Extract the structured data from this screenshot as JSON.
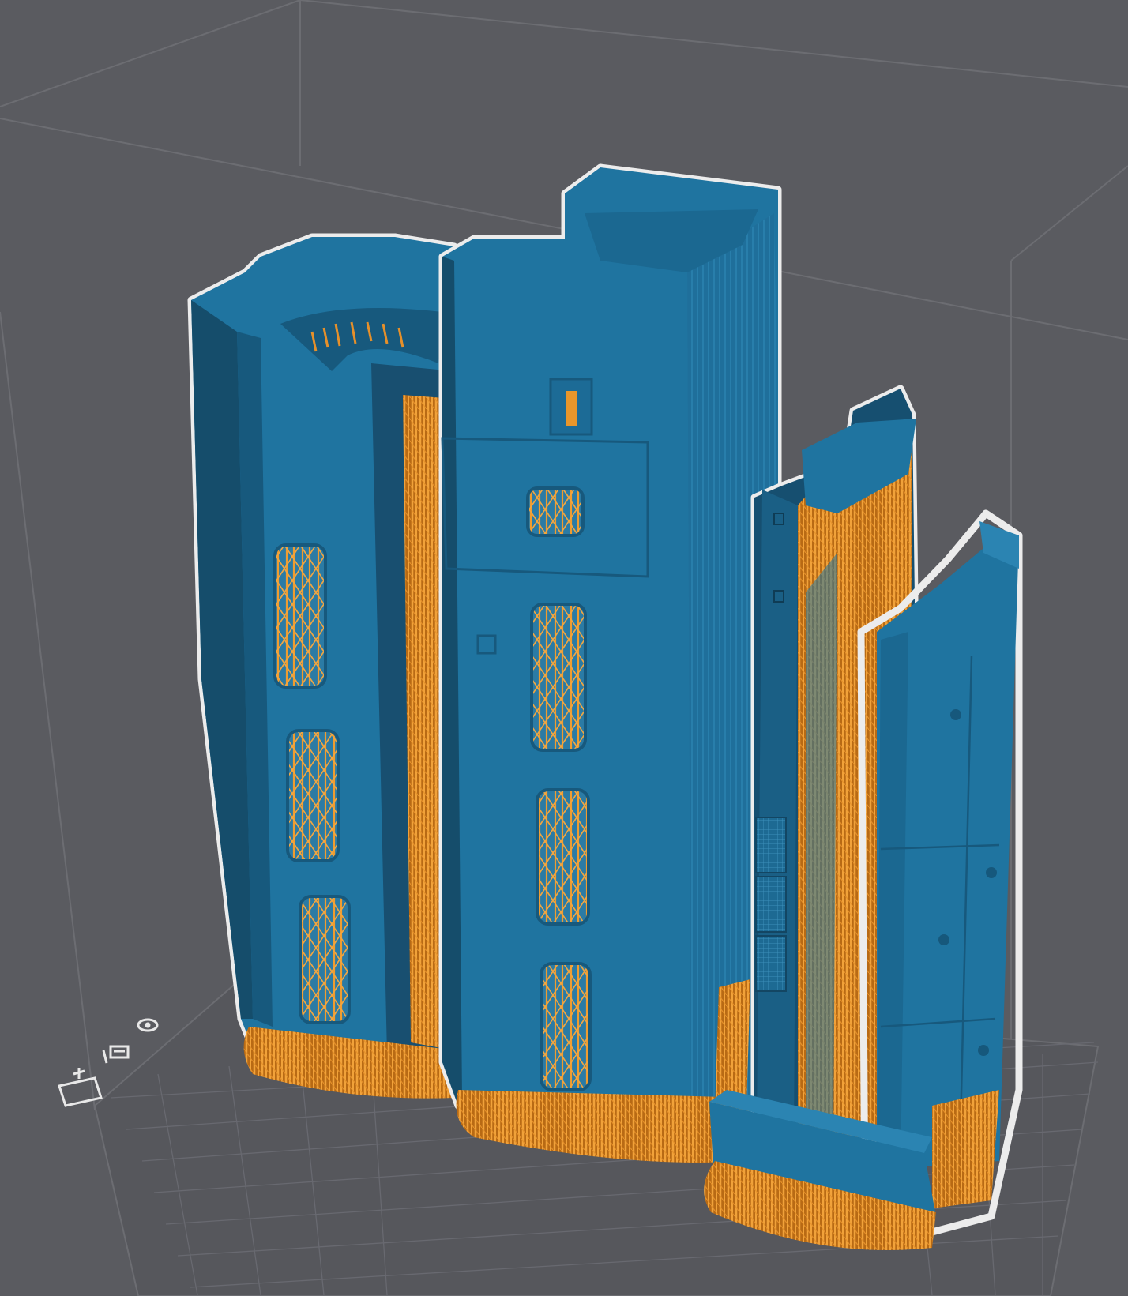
{
  "viewport": {
    "background": "#5a5b60",
    "model_color": "#1f74a0",
    "support_color": "#e4901f",
    "grid_color": "#6a6b70",
    "outline_color": "#e6e6e6"
  },
  "axis_icons": [
    {
      "name": "eye-icon"
    },
    {
      "name": "layer-list-icon"
    },
    {
      "name": "grid-add-icon"
    }
  ],
  "objects": [
    {
      "name": "left-tower-part"
    },
    {
      "name": "center-tower-part"
    },
    {
      "name": "right-panel-part"
    },
    {
      "name": "front-bracket-part"
    }
  ]
}
